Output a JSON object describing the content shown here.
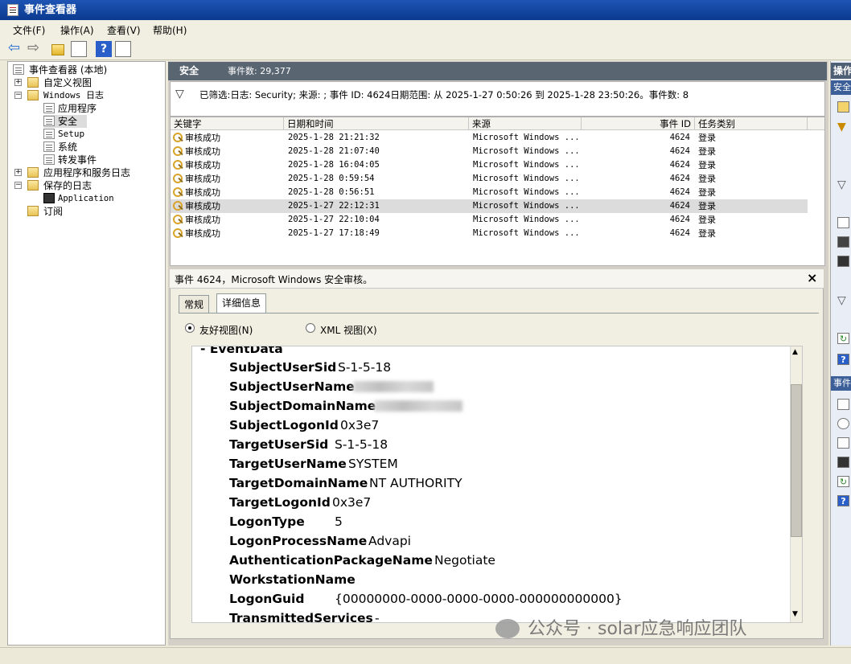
{
  "window": {
    "title": "事件查看器"
  },
  "menu": [
    {
      "label": "文件(F)"
    },
    {
      "label": "操作(A)"
    },
    {
      "label": "查看(V)"
    },
    {
      "label": "帮助(H)"
    }
  ],
  "tree": {
    "root": "事件查看器 (本地)",
    "custom_views": "自定义视图",
    "windows_logs": "Windows 日志",
    "application": "应用程序",
    "security": "安全",
    "setup": "Setup",
    "system": "系统",
    "forwarded": "转发事件",
    "app_service_logs": "应用程序和服务日志",
    "saved_logs": "保存的日志",
    "saved_application": "Application",
    "subscriptions": "订阅"
  },
  "header": {
    "title": "安全",
    "count_label": "事件数: 29,377"
  },
  "filter": {
    "text": "已筛选:日志: Security; 来源: ; 事件 ID: 4624日期范围: 从 2025-1-27 0:50:26 到 2025-1-28 23:50:26。事件数: 8"
  },
  "grid": {
    "columns": [
      "关键字",
      "日期和时间",
      "来源",
      "事件 ID",
      "任务类别"
    ],
    "rows": [
      {
        "keyword": "审核成功",
        "datetime": "2025-1-28 21:21:32",
        "source": "Microsoft Windows ...",
        "id": "4624",
        "category": "登录"
      },
      {
        "keyword": "审核成功",
        "datetime": "2025-1-28 21:07:40",
        "source": "Microsoft Windows ...",
        "id": "4624",
        "category": "登录"
      },
      {
        "keyword": "审核成功",
        "datetime": "2025-1-28 16:04:05",
        "source": "Microsoft Windows ...",
        "id": "4624",
        "category": "登录"
      },
      {
        "keyword": "审核成功",
        "datetime": "2025-1-28 0:59:54",
        "source": "Microsoft Windows ...",
        "id": "4624",
        "category": "登录"
      },
      {
        "keyword": "审核成功",
        "datetime": "2025-1-28 0:56:51",
        "source": "Microsoft Windows ...",
        "id": "4624",
        "category": "登录"
      },
      {
        "keyword": "审核成功",
        "datetime": "2025-1-27 22:12:31",
        "source": "Microsoft Windows ...",
        "id": "4624",
        "category": "登录"
      },
      {
        "keyword": "审核成功",
        "datetime": "2025-1-27 22:10:04",
        "source": "Microsoft Windows ...",
        "id": "4624",
        "category": "登录"
      },
      {
        "keyword": "审核成功",
        "datetime": "2025-1-27 17:18:49",
        "source": "Microsoft Windows ...",
        "id": "4624",
        "category": "登录"
      }
    ]
  },
  "event_detail": {
    "title": "事件 4624，Microsoft Windows 安全审核。",
    "close": "×",
    "tabs": [
      "常规",
      "详细信息"
    ],
    "view_friendly": "友好视图(N)",
    "view_xml": "XML 视图(X)",
    "section": "- EventData",
    "fields": [
      {
        "name": "SubjectUserSid",
        "value": "S-1-5-18"
      },
      {
        "name": "SubjectUserName",
        "value": ""
      },
      {
        "name": "SubjectDomainName",
        "value": ""
      },
      {
        "name": "SubjectLogonId",
        "value": "0x3e7"
      },
      {
        "name": "TargetUserSid",
        "value": "S-1-5-18"
      },
      {
        "name": "TargetUserName",
        "value": "SYSTEM"
      },
      {
        "name": "TargetDomainName",
        "value": "NT AUTHORITY"
      },
      {
        "name": "TargetLogonId",
        "value": "0x3e7"
      },
      {
        "name": "LogonType",
        "value": "5"
      },
      {
        "name": "LogonProcessName",
        "value": "Advapi"
      },
      {
        "name": "AuthenticationPackageName",
        "value": "Negotiate"
      },
      {
        "name": "WorkstationName",
        "value": ""
      },
      {
        "name": "LogonGuid",
        "value": "{00000000-0000-0000-0000-000000000000}"
      },
      {
        "name": "TransmittedServices",
        "value": "-"
      }
    ]
  },
  "actions": {
    "header": "操作",
    "section1": "安全",
    "section2": "事件"
  },
  "watermark": "公众号 · solar应急响应团队"
}
